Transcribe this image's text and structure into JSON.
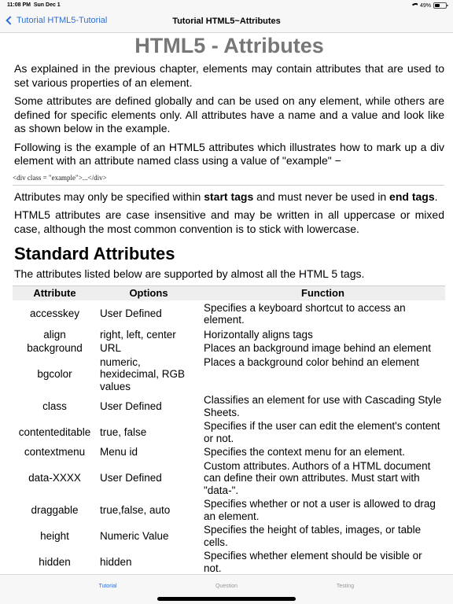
{
  "status": {
    "time": "11:08 PM",
    "date": "Sun Dec 1",
    "battery": "49%",
    "battery_level": 0.49,
    "icons": [
      "wifi-icon",
      "battery-icon"
    ]
  },
  "nav": {
    "back_label": "Tutorial HTML5-Tutorial",
    "title": "Tutorial HTML5~Attributes",
    "accent": "#2f6fd6"
  },
  "page": {
    "heading": "HTML5 - Attributes",
    "paragraphs": [
      "As explained in the previous chapter, elements may contain attributes that are used to set various properties of an element.",
      "Some attributes are defined globally and can be used on any element, while others are defined for specific elements only. All attributes have a name and a value and look like as shown below in the example.",
      "Following is the example of an HTML5 attributes which illustrates how to mark up a div element with an attribute named class using a value of \"example\" −"
    ],
    "code": "<div class = \"example\">...</div>",
    "para4": {
      "before": "Attributes may only be specified within ",
      "bold1": "start tags",
      "middle": " and must never be used in ",
      "bold2": "end tags",
      "after": "."
    },
    "para5": "HTML5 attributes are case insensitive and may be written in all uppercase or mixed case, although the most common convention is to stick with lowercase.",
    "section_title": "Standard Attributes",
    "intro": "The attributes listed below are supported by almost all the HTML 5 tags."
  },
  "table": {
    "headers": [
      "Attribute",
      "Options",
      "Function"
    ],
    "rows": [
      [
        "accesskey",
        "User Defined",
        "Specifies a keyboard shortcut to access an element."
      ],
      [
        "align",
        "right, left, center",
        "Horizontally aligns tags"
      ],
      [
        "background",
        "URL",
        "Places an background image behind an element"
      ],
      [
        "bgcolor",
        "numeric, hexidecimal, RGB values",
        "Places a background color behind an element"
      ],
      [
        "class",
        "User Defined",
        "Classifies an element for use with Cascading Style Sheets."
      ],
      [
        "contenteditable",
        "true, false",
        "Specifies if the user can edit the element's content or not."
      ],
      [
        "contextmenu",
        "Menu id",
        "Specifies the context menu for an element."
      ],
      [
        "data-XXXX",
        "User Defined",
        "Custom attributes. Authors of a HTML document can define their own attributes. Must start with \"data-\"."
      ],
      [
        "draggable",
        "true,false, auto",
        "Specifies whether or not a user is allowed to drag an element."
      ],
      [
        "height",
        "Numeric Value",
        "Specifies the height of tables, images, or table cells."
      ],
      [
        "hidden",
        "hidden",
        "Specifies whether element should be visible or not."
      ]
    ]
  },
  "tabs": [
    {
      "label": "Tutorial",
      "active": true
    },
    {
      "label": "Question",
      "active": false
    },
    {
      "label": "Testing",
      "active": false
    }
  ]
}
